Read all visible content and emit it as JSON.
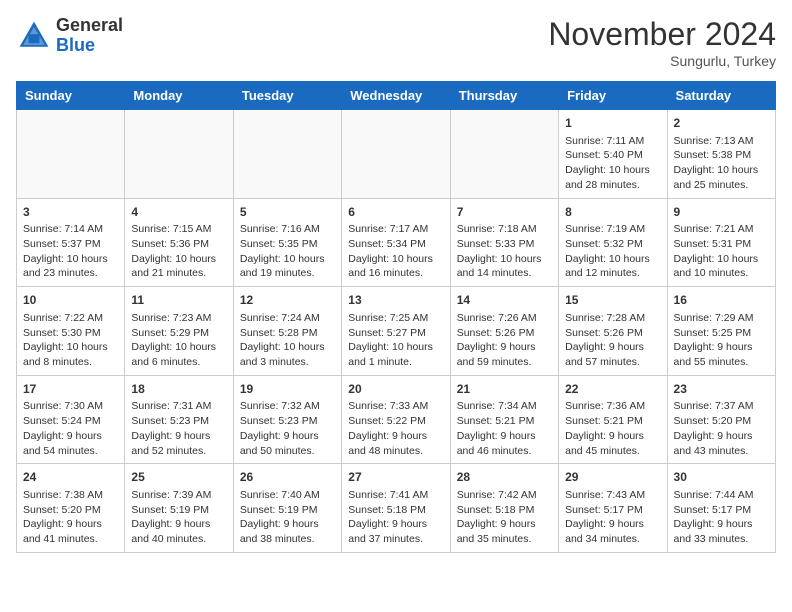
{
  "header": {
    "logo_line1": "General",
    "logo_line2": "Blue",
    "month_title": "November 2024",
    "location": "Sungurlu, Turkey"
  },
  "weekdays": [
    "Sunday",
    "Monday",
    "Tuesday",
    "Wednesday",
    "Thursday",
    "Friday",
    "Saturday"
  ],
  "weeks": [
    [
      {
        "day": "",
        "info": ""
      },
      {
        "day": "",
        "info": ""
      },
      {
        "day": "",
        "info": ""
      },
      {
        "day": "",
        "info": ""
      },
      {
        "day": "",
        "info": ""
      },
      {
        "day": "1",
        "info": "Sunrise: 7:11 AM\nSunset: 5:40 PM\nDaylight: 10 hours and 28 minutes."
      },
      {
        "day": "2",
        "info": "Sunrise: 7:13 AM\nSunset: 5:38 PM\nDaylight: 10 hours and 25 minutes."
      }
    ],
    [
      {
        "day": "3",
        "info": "Sunrise: 7:14 AM\nSunset: 5:37 PM\nDaylight: 10 hours and 23 minutes."
      },
      {
        "day": "4",
        "info": "Sunrise: 7:15 AM\nSunset: 5:36 PM\nDaylight: 10 hours and 21 minutes."
      },
      {
        "day": "5",
        "info": "Sunrise: 7:16 AM\nSunset: 5:35 PM\nDaylight: 10 hours and 19 minutes."
      },
      {
        "day": "6",
        "info": "Sunrise: 7:17 AM\nSunset: 5:34 PM\nDaylight: 10 hours and 16 minutes."
      },
      {
        "day": "7",
        "info": "Sunrise: 7:18 AM\nSunset: 5:33 PM\nDaylight: 10 hours and 14 minutes."
      },
      {
        "day": "8",
        "info": "Sunrise: 7:19 AM\nSunset: 5:32 PM\nDaylight: 10 hours and 12 minutes."
      },
      {
        "day": "9",
        "info": "Sunrise: 7:21 AM\nSunset: 5:31 PM\nDaylight: 10 hours and 10 minutes."
      }
    ],
    [
      {
        "day": "10",
        "info": "Sunrise: 7:22 AM\nSunset: 5:30 PM\nDaylight: 10 hours and 8 minutes."
      },
      {
        "day": "11",
        "info": "Sunrise: 7:23 AM\nSunset: 5:29 PM\nDaylight: 10 hours and 6 minutes."
      },
      {
        "day": "12",
        "info": "Sunrise: 7:24 AM\nSunset: 5:28 PM\nDaylight: 10 hours and 3 minutes."
      },
      {
        "day": "13",
        "info": "Sunrise: 7:25 AM\nSunset: 5:27 PM\nDaylight: 10 hours and 1 minute."
      },
      {
        "day": "14",
        "info": "Sunrise: 7:26 AM\nSunset: 5:26 PM\nDaylight: 9 hours and 59 minutes."
      },
      {
        "day": "15",
        "info": "Sunrise: 7:28 AM\nSunset: 5:26 PM\nDaylight: 9 hours and 57 minutes."
      },
      {
        "day": "16",
        "info": "Sunrise: 7:29 AM\nSunset: 5:25 PM\nDaylight: 9 hours and 55 minutes."
      }
    ],
    [
      {
        "day": "17",
        "info": "Sunrise: 7:30 AM\nSunset: 5:24 PM\nDaylight: 9 hours and 54 minutes."
      },
      {
        "day": "18",
        "info": "Sunrise: 7:31 AM\nSunset: 5:23 PM\nDaylight: 9 hours and 52 minutes."
      },
      {
        "day": "19",
        "info": "Sunrise: 7:32 AM\nSunset: 5:23 PM\nDaylight: 9 hours and 50 minutes."
      },
      {
        "day": "20",
        "info": "Sunrise: 7:33 AM\nSunset: 5:22 PM\nDaylight: 9 hours and 48 minutes."
      },
      {
        "day": "21",
        "info": "Sunrise: 7:34 AM\nSunset: 5:21 PM\nDaylight: 9 hours and 46 minutes."
      },
      {
        "day": "22",
        "info": "Sunrise: 7:36 AM\nSunset: 5:21 PM\nDaylight: 9 hours and 45 minutes."
      },
      {
        "day": "23",
        "info": "Sunrise: 7:37 AM\nSunset: 5:20 PM\nDaylight: 9 hours and 43 minutes."
      }
    ],
    [
      {
        "day": "24",
        "info": "Sunrise: 7:38 AM\nSunset: 5:20 PM\nDaylight: 9 hours and 41 minutes."
      },
      {
        "day": "25",
        "info": "Sunrise: 7:39 AM\nSunset: 5:19 PM\nDaylight: 9 hours and 40 minutes."
      },
      {
        "day": "26",
        "info": "Sunrise: 7:40 AM\nSunset: 5:19 PM\nDaylight: 9 hours and 38 minutes."
      },
      {
        "day": "27",
        "info": "Sunrise: 7:41 AM\nSunset: 5:18 PM\nDaylight: 9 hours and 37 minutes."
      },
      {
        "day": "28",
        "info": "Sunrise: 7:42 AM\nSunset: 5:18 PM\nDaylight: 9 hours and 35 minutes."
      },
      {
        "day": "29",
        "info": "Sunrise: 7:43 AM\nSunset: 5:17 PM\nDaylight: 9 hours and 34 minutes."
      },
      {
        "day": "30",
        "info": "Sunrise: 7:44 AM\nSunset: 5:17 PM\nDaylight: 9 hours and 33 minutes."
      }
    ]
  ]
}
